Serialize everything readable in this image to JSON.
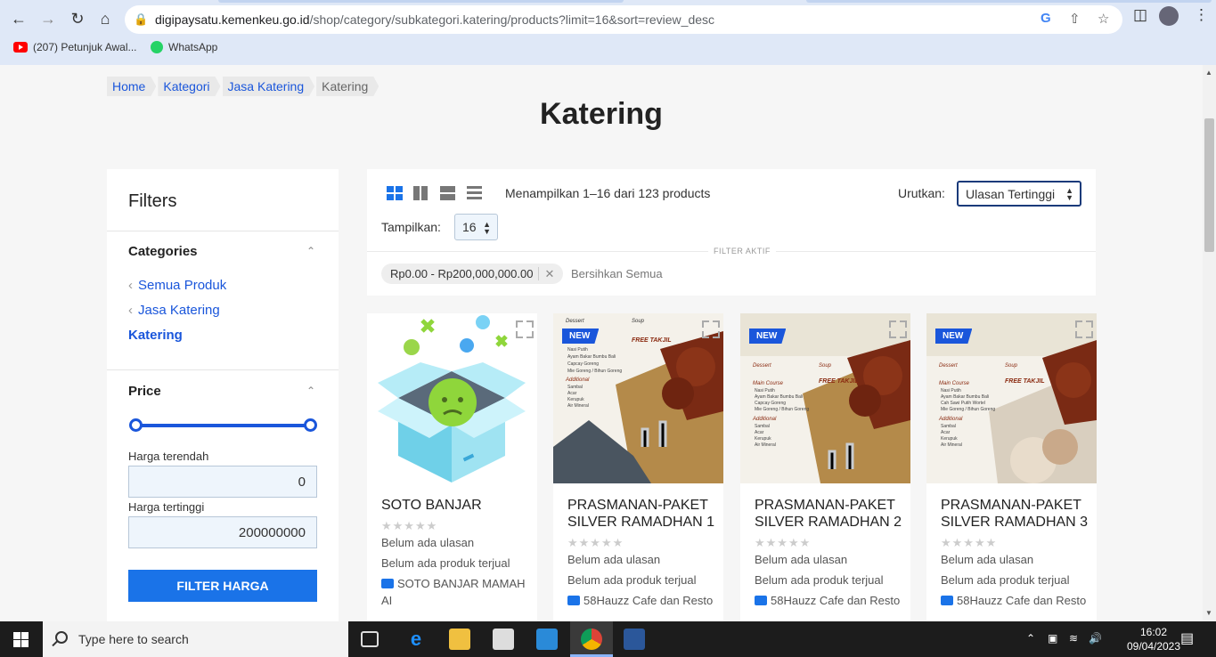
{
  "browser": {
    "url_host": "digipaysatu.kemenkeu.go.id",
    "url_path": "/shop/category/subkategori.katering/products?limit=16&sort=review_desc",
    "bookmarks": [
      {
        "label": "(207) Petunjuk Awal..."
      },
      {
        "label": "WhatsApp"
      }
    ]
  },
  "breadcrumb": [
    "Home",
    "Kategori",
    "Jasa Katering",
    "Katering"
  ],
  "page_title": "Katering",
  "filters": {
    "title": "Filters",
    "categories_heading": "Categories",
    "categories": [
      "Semua Produk",
      "Jasa Katering",
      "Katering"
    ],
    "price_heading": "Price",
    "price_range_fraction": [
      0,
      1
    ],
    "min_label": "Harga terendah",
    "min_value": "0",
    "max_label": "Harga tertinggi",
    "max_value": "200000000",
    "button_label": "FILTER HARGA"
  },
  "toolbar": {
    "result_count": "Menampilkan 1–16 dari 123 products",
    "sort_label": "Urutkan:",
    "sort_value": "Ulasan Tertinggi",
    "show_label": "Tampilkan:",
    "show_value": "16",
    "active_filter_label": "FILTER AKTIF",
    "active_chip": "Rp0.00 - Rp200,000,000.00",
    "clear_all": "Bersihkan Semua"
  },
  "products": [
    {
      "name": "SOTO BANJAR",
      "badge": "",
      "rating": "Belum ada ulasan",
      "sold": "Belum ada produk terjual",
      "store": "SOTO BANJAR MAMAH AI"
    },
    {
      "name": "PRASMANAN-PAKET SILVER RAMADHAN 1",
      "badge": "NEW",
      "rating": "Belum ada ulasan",
      "sold": "Belum ada produk terjual",
      "store": "58Hauzz Cafe dan Resto"
    },
    {
      "name": "PRASMANAN-PAKET SILVER RAMADHAN 2",
      "badge": "NEW",
      "rating": "Belum ada ulasan",
      "sold": "Belum ada produk terjual",
      "store": "58Hauzz Cafe dan Resto"
    },
    {
      "name": "PRASMANAN-PAKET SILVER RAMADHAN 3",
      "badge": "NEW",
      "rating": "Belum ada ulasan",
      "sold": "Belum ada produk terjual",
      "store": "58Hauzz Cafe dan Resto"
    }
  ],
  "taskbar": {
    "search_placeholder": "Type here to search",
    "time": "16:02",
    "date": "09/04/2023"
  },
  "colors": {
    "accent": "#1a73e8",
    "link": "#1a56db"
  }
}
